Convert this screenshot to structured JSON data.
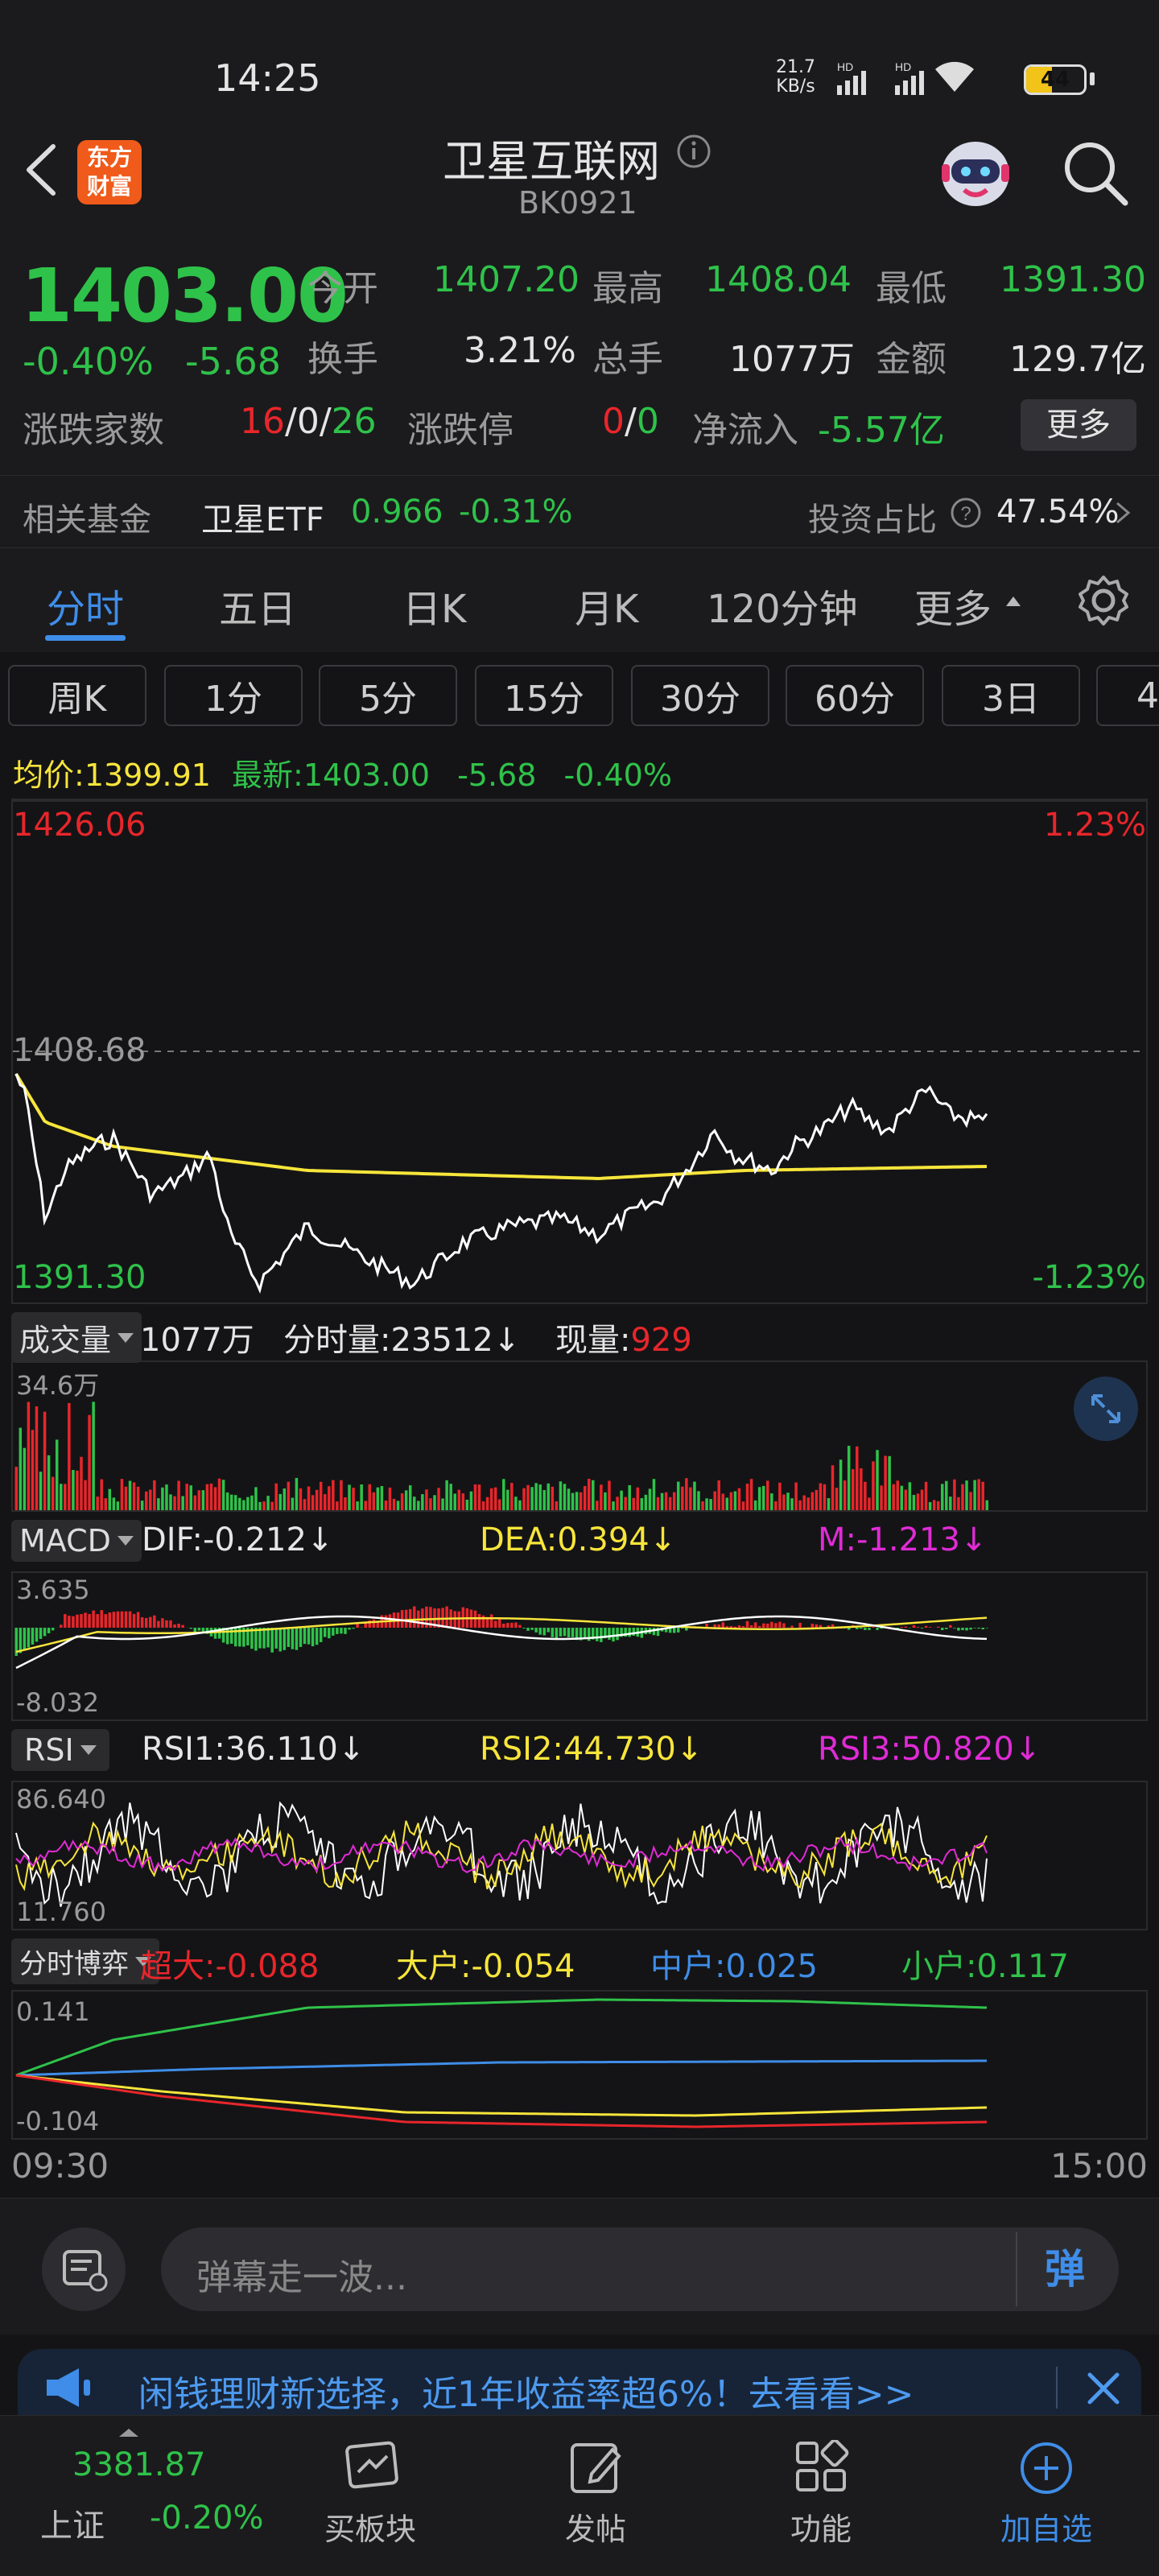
{
  "status": {
    "time": "14:25",
    "net_speed": "21.7",
    "net_unit": "KB/s",
    "battery": "44"
  },
  "header": {
    "logo_top": "东方",
    "logo_bottom": "财富",
    "title": "卫星互联网",
    "code": "BK0921"
  },
  "quote": {
    "price": "1403.00",
    "change_pct": "-0.40%",
    "change": "-5.68",
    "open_label": "今开",
    "open": "1407.20",
    "high_label": "最高",
    "high": "1408.04",
    "low_label": "最低",
    "low": "1391.30",
    "turnover_label": "换手",
    "turnover": "3.21%",
    "volume_label": "总手",
    "volume": "1077万",
    "amount_label": "金额",
    "amount": "129.7亿",
    "breadth_label": "涨跌家数",
    "up_count": "16",
    "flat_count": "0",
    "down_count": "26",
    "limit_label": "涨跌停",
    "limit_up": "0",
    "limit_down": "0",
    "inflow_label": "净流入",
    "inflow": "-5.57亿",
    "more": "更多"
  },
  "fund": {
    "label": "相关基金",
    "name": "卫星ETF",
    "price": "0.966",
    "change": "-0.31%",
    "ratio_label": "投资占比",
    "ratio": "47.54%"
  },
  "tabs": [
    "分时",
    "五日",
    "日K",
    "月K",
    "120分钟",
    "更多"
  ],
  "chips": [
    "周K",
    "1分",
    "5分",
    "15分",
    "30分",
    "60分",
    "3日",
    "4"
  ],
  "intraday": {
    "avg_label": "均价:",
    "avg": "1399.91",
    "last_label": "最新:",
    "last": "1403.00",
    "chg": "-5.68",
    "chg_pct": "-0.40%",
    "y_top": "1426.06",
    "y_mid": "1408.68",
    "y_bottom": "1391.30",
    "pct_top": "1.23%",
    "pct_bottom": "-1.23%"
  },
  "volume": {
    "selector": "成交量",
    "total": "1077万",
    "tick_label": "分时量:23512",
    "tick_arrow": "↓",
    "cur_label": "现量:",
    "cur": "929",
    "max": "34.6万"
  },
  "macd": {
    "selector": "MACD",
    "dif": "DIF:-0.212",
    "dea": "DEA:0.394",
    "m": "M:-1.213",
    "arrow": "↓",
    "top": "3.635",
    "bottom": "-8.032"
  },
  "rsi": {
    "selector": "RSI",
    "rsi1": "RSI1:36.110",
    "rsi2": "RSI2:44.730",
    "rsi3": "RSI3:50.820",
    "arrow": "↓",
    "top": "86.640",
    "bottom": "11.760"
  },
  "flow": {
    "selector": "分时博弈",
    "super": "超大:-0.088",
    "large": "大户:-0.054",
    "mid": "中户:0.025",
    "small": "小户:0.117",
    "top": "0.141",
    "bottom": "-0.104"
  },
  "time_axis": {
    "start": "09:30",
    "end": "15:00"
  },
  "comment": {
    "placeholder": "弹幕走一波...",
    "dan": "弹"
  },
  "banner": {
    "text": "闲钱理财新选择，近1年收益率超6%！去看看>>"
  },
  "nav": {
    "index_value": "3381.87",
    "index_name": "上证",
    "index_change": "-0.20%",
    "items": [
      "买板块",
      "发帖",
      "功能",
      "加自选"
    ]
  }
}
